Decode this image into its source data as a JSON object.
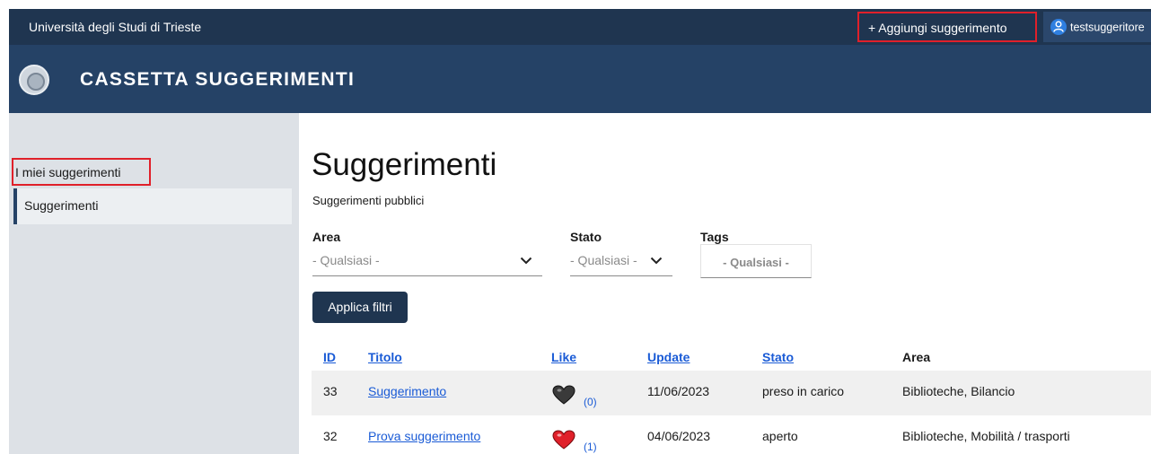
{
  "topbar": {
    "university": "Università degli Studi di Trieste",
    "add_suggestion": "+ Aggiungi suggerimento",
    "user": "testsuggeritore",
    "user_icon": "user-icon"
  },
  "header": {
    "logo_icon": "university-seal",
    "title": "CASSETTA SUGGERIMENTI"
  },
  "sidebar": {
    "items": [
      {
        "label": "I miei suggerimenti"
      },
      {
        "label": "Suggerimenti"
      }
    ]
  },
  "main": {
    "title": "Suggerimenti",
    "subtitle": "Suggerimenti pubblici",
    "filters": {
      "area": {
        "label": "Area",
        "value": "- Qualsiasi -"
      },
      "stato": {
        "label": "Stato",
        "value": "- Qualsiasi -"
      },
      "tags": {
        "label": "Tags",
        "value": "- Qualsiasi -"
      }
    },
    "apply_button": "Applica filtri"
  },
  "table": {
    "headers": {
      "id": "ID",
      "titolo": "Titolo",
      "like": "Like",
      "update": "Update",
      "stato": "Stato",
      "area": "Area"
    },
    "rows": [
      {
        "id": "33",
        "titolo": "Suggerimento",
        "like_count": "(0)",
        "liked": false,
        "update": "11/06/2023",
        "stato": "preso in carico",
        "area": "Biblioteche, Bilancio"
      },
      {
        "id": "32",
        "titolo": "Prova suggerimento",
        "like_count": "(1)",
        "liked": true,
        "update": "04/06/2023",
        "stato": "aperto",
        "area": "Biblioteche, Mobilità / trasporti"
      }
    ]
  },
  "colors": {
    "topbar": "#1f3550",
    "header": "#254266",
    "link": "#1a5bd6",
    "highlight": "#e0202a",
    "heart_liked": "#e0202a",
    "heart_unliked": "#333333"
  }
}
